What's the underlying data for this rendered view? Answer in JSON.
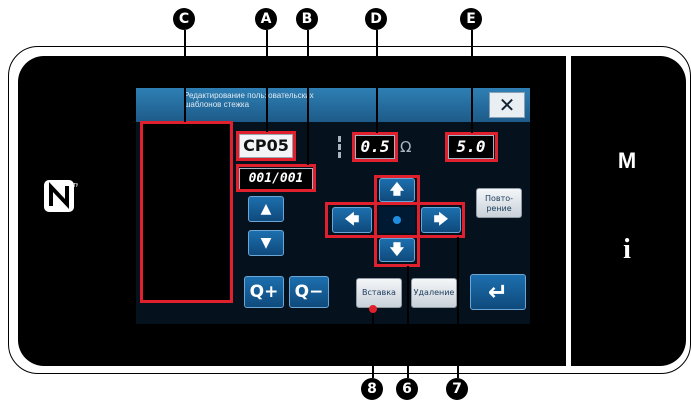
{
  "dialog": {
    "title": "Редактирование пользовательских\nшаблонов стежка",
    "close_label": "✕"
  },
  "pattern": {
    "code": "CP05",
    "counter": "001/001",
    "pitch_value": "0.5",
    "tension_value": "5.0",
    "pitch_icon": "stitch-pitch-icon",
    "tension_icon": "thread-tension-icon"
  },
  "controls": {
    "up_label": "▲",
    "down_label": "▼",
    "move_up_label": "🡅",
    "move_down_label": "🡇",
    "move_left_label": "🡄",
    "move_right_label": "🡆",
    "repeat_label": "Повто-\nрение",
    "zoom_in_label": "Q+",
    "zoom_out_label": "Q−",
    "insert_label": "Вставка",
    "delete_label": "Удаление",
    "enter_label": "↵"
  },
  "side_panel": {
    "m_label": "M",
    "info_label": "i"
  },
  "callouts": {
    "a": "A",
    "b": "B",
    "c": "C",
    "d": "D",
    "e": "E",
    "n6": "6",
    "n7": "7",
    "n8": "8"
  },
  "colors": {
    "highlight": "#e0202c",
    "titlebar": "#2e7fb4",
    "button": "#1c6fae"
  }
}
